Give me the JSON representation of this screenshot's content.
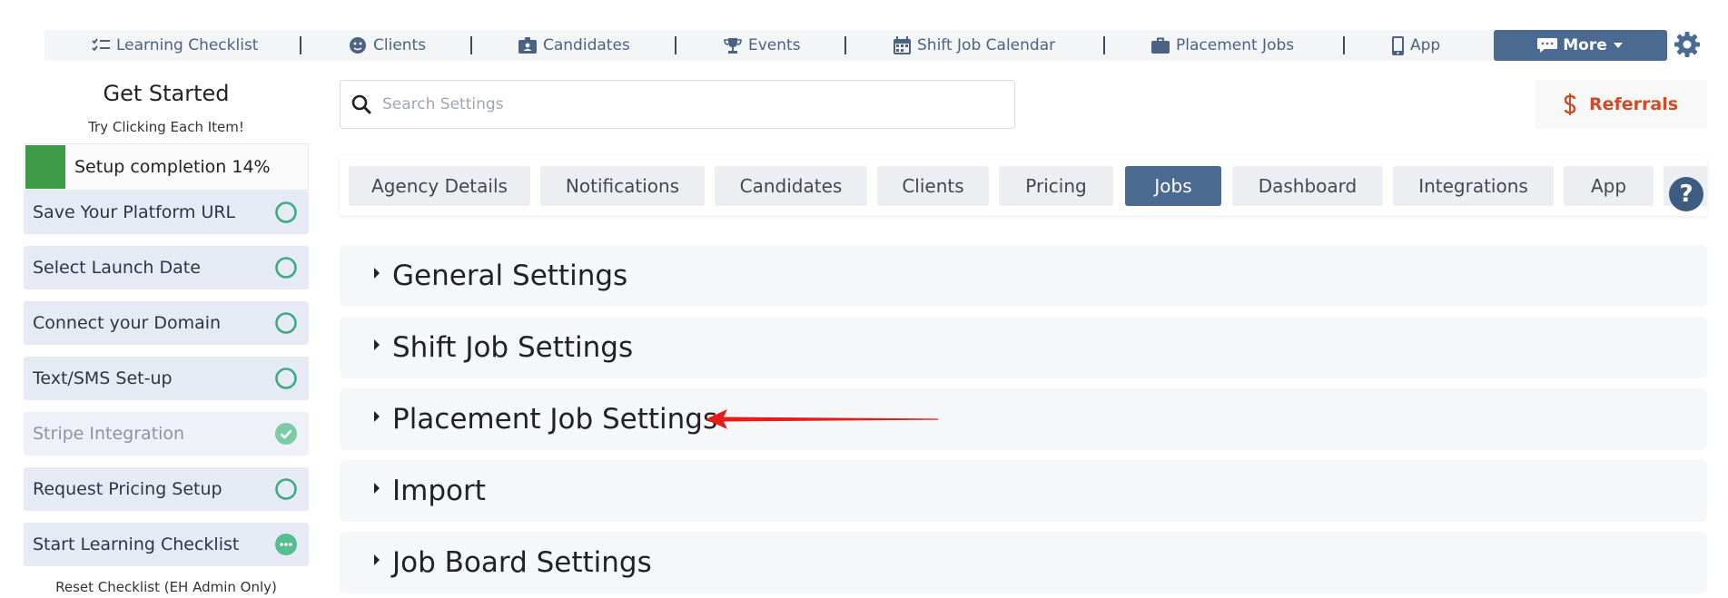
{
  "nav": {
    "items": [
      {
        "label": "Learning Checklist",
        "icon": "checklist-icon"
      },
      {
        "label": "Clients",
        "icon": "face-icon"
      },
      {
        "label": "Candidates",
        "icon": "id-badge-icon"
      },
      {
        "label": "Events",
        "icon": "trophy-icon"
      },
      {
        "label": "Shift Job Calendar",
        "icon": "calendar-icon"
      },
      {
        "label": "Placement Jobs",
        "icon": "briefcase-icon"
      },
      {
        "label": "App",
        "icon": "mobile-icon"
      }
    ],
    "more_label": "More",
    "settings_icon": "gear-icon"
  },
  "sidebar": {
    "title": "Get Started",
    "subtitle": "Try Clicking Each Item!",
    "progress_label": "Setup completion 14%",
    "progress_percent": 14,
    "items": [
      {
        "label": "Save Your Platform URL",
        "status": "pending"
      },
      {
        "label": "Select Launch Date",
        "status": "pending"
      },
      {
        "label": "Connect your Domain",
        "status": "pending"
      },
      {
        "label": "Text/SMS Set-up",
        "status": "pending"
      },
      {
        "label": "Stripe Integration",
        "status": "done"
      },
      {
        "label": "Request Pricing Setup",
        "status": "pending"
      },
      {
        "label": "Start Learning Checklist",
        "status": "in-progress"
      }
    ],
    "reset_label": "Reset Checklist (EH Admin Only)"
  },
  "search": {
    "placeholder": "Search Settings",
    "value": ""
  },
  "referrals_label": "Referrals",
  "tabs": [
    {
      "label": "Agency Details",
      "active": false
    },
    {
      "label": "Notifications",
      "active": false
    },
    {
      "label": "Candidates",
      "active": false
    },
    {
      "label": "Clients",
      "active": false
    },
    {
      "label": "Pricing",
      "active": false
    },
    {
      "label": "Jobs",
      "active": true
    },
    {
      "label": "Dashboard",
      "active": false
    },
    {
      "label": "Integrations",
      "active": false
    },
    {
      "label": "App",
      "active": false
    }
  ],
  "help_label": "?",
  "sections": [
    {
      "title": "General Settings"
    },
    {
      "title": "Shift Job Settings"
    },
    {
      "title": "Placement Job Settings"
    },
    {
      "title": "Import"
    },
    {
      "title": "Job Board Settings"
    }
  ],
  "colors": {
    "accent": "#4a6a91",
    "progress": "#3d9b48",
    "check_ring": "#3daa82",
    "referrals": "#d14a28",
    "annotation_arrow": "#e31c1c"
  }
}
